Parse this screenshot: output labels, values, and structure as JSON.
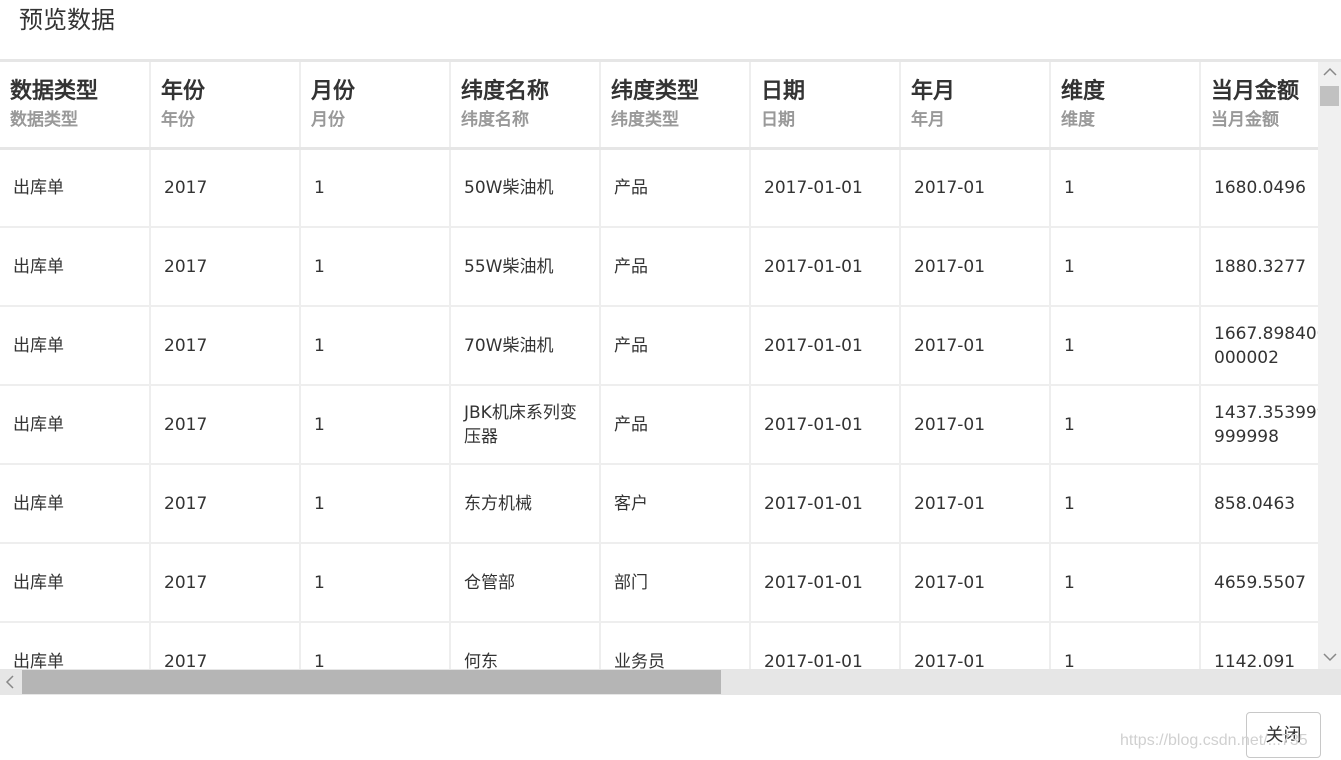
{
  "dialog": {
    "title": "预览数据",
    "close_label": "关闭"
  },
  "table": {
    "columns": [
      {
        "label": "数据类型",
        "sublabel": "数据类型"
      },
      {
        "label": "年份",
        "sublabel": "年份"
      },
      {
        "label": "月份",
        "sublabel": "月份"
      },
      {
        "label": "纬度名称",
        "sublabel": "纬度名称"
      },
      {
        "label": "纬度类型",
        "sublabel": "纬度类型"
      },
      {
        "label": "日期",
        "sublabel": "日期"
      },
      {
        "label": "年月",
        "sublabel": "年月"
      },
      {
        "label": "维度",
        "sublabel": "维度"
      },
      {
        "label": "当月金额",
        "sublabel": "当月金额"
      }
    ],
    "rows": [
      [
        "出库单",
        "2017",
        "1",
        "50W柴油机",
        "产品",
        "2017-01-01",
        "2017-01",
        "1",
        "1680.0496"
      ],
      [
        "出库单",
        "2017",
        "1",
        "55W柴油机",
        "产品",
        "2017-01-01",
        "2017-01",
        "1",
        "1880.3277"
      ],
      [
        "出库单",
        "2017",
        "1",
        "70W柴油机",
        "产品",
        "2017-01-01",
        "2017-01",
        "1",
        "1667.8984000000002"
      ],
      [
        "出库单",
        "2017",
        "1",
        "JBK机床系列变压器",
        "产品",
        "2017-01-01",
        "2017-01",
        "1",
        "1437.3539999999998"
      ],
      [
        "出库单",
        "2017",
        "1",
        "东方机械",
        "客户",
        "2017-01-01",
        "2017-01",
        "1",
        "858.0463"
      ],
      [
        "出库单",
        "2017",
        "1",
        "仓管部",
        "部门",
        "2017-01-01",
        "2017-01",
        "1",
        "4659.5507"
      ],
      [
        "出库单",
        "2017",
        "1",
        "何东",
        "业务员",
        "2017-01-01",
        "2017-01",
        "1",
        "1142.091"
      ]
    ]
  },
  "scrollbars": {
    "up_icon": "chevron-up-icon",
    "down_icon": "chevron-down-icon",
    "left_icon": "chevron-left-icon"
  },
  "watermark": "https://blog.csdn.net/...735"
}
